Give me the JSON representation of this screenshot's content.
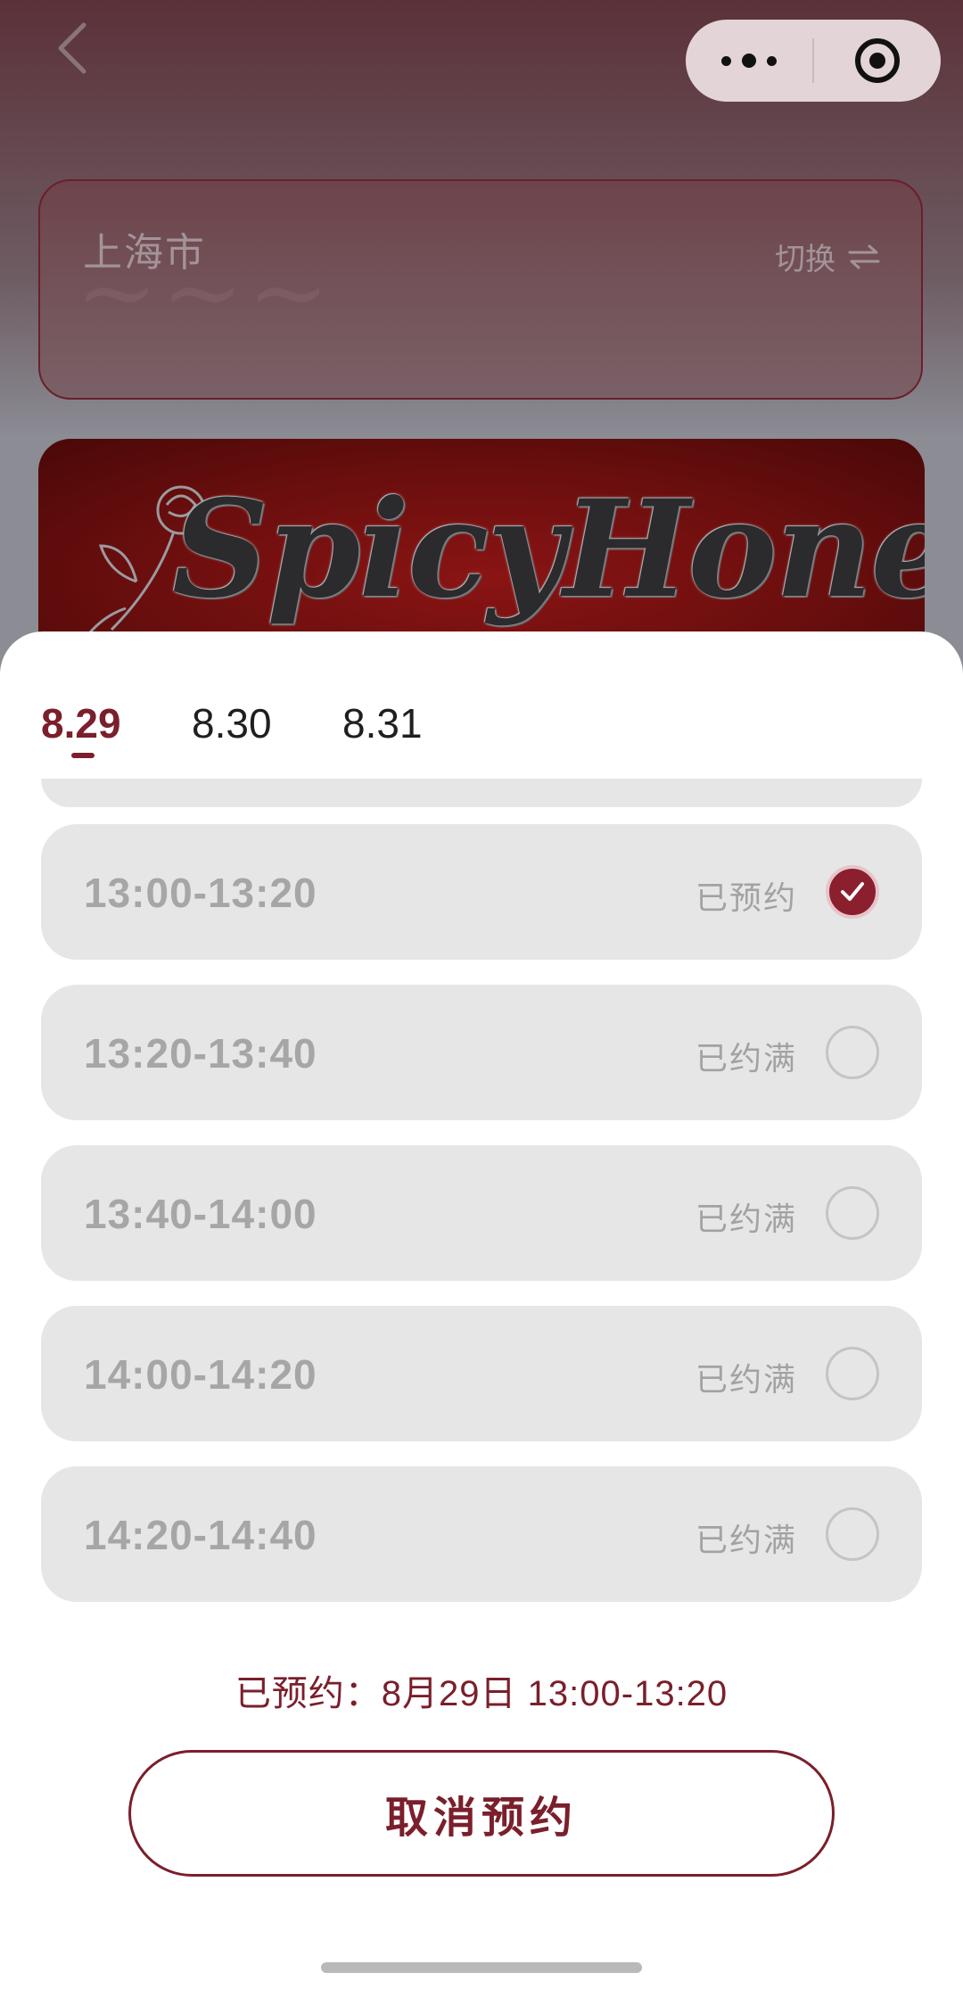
{
  "top_bar": {
    "back_icon": "chevron-left-icon",
    "capsule": {
      "more_icon": "more-dots-icon",
      "target_icon": "target-icon"
    }
  },
  "city_card": {
    "city": "上海市",
    "switch_label": "切换",
    "switch_icon": "swap-arrows-icon"
  },
  "banner": {
    "title": "SpicyHoney",
    "icon": "rose-icon"
  },
  "sheet": {
    "date_tabs": [
      {
        "label": "8.29",
        "active": true
      },
      {
        "label": "8.30",
        "active": false
      },
      {
        "label": "8.31",
        "active": false
      }
    ],
    "slots": [
      {
        "time": "13:00-13:20",
        "status": "已预约",
        "checked": true
      },
      {
        "time": "13:20-13:40",
        "status": "已约满",
        "checked": false
      },
      {
        "time": "13:40-14:00",
        "status": "已约满",
        "checked": false
      },
      {
        "time": "14:00-14:20",
        "status": "已约满",
        "checked": false
      },
      {
        "time": "14:20-14:40",
        "status": "已约满",
        "checked": false
      }
    ],
    "booked_summary": "已预约：8月29日 13:00-13:20",
    "cancel_label": "取消预约"
  },
  "colors": {
    "accent": "#7a1f2b",
    "check_fill": "#8b1f2d",
    "slot_bg": "#e6e6e6",
    "muted_text": "#a6a6a6"
  }
}
